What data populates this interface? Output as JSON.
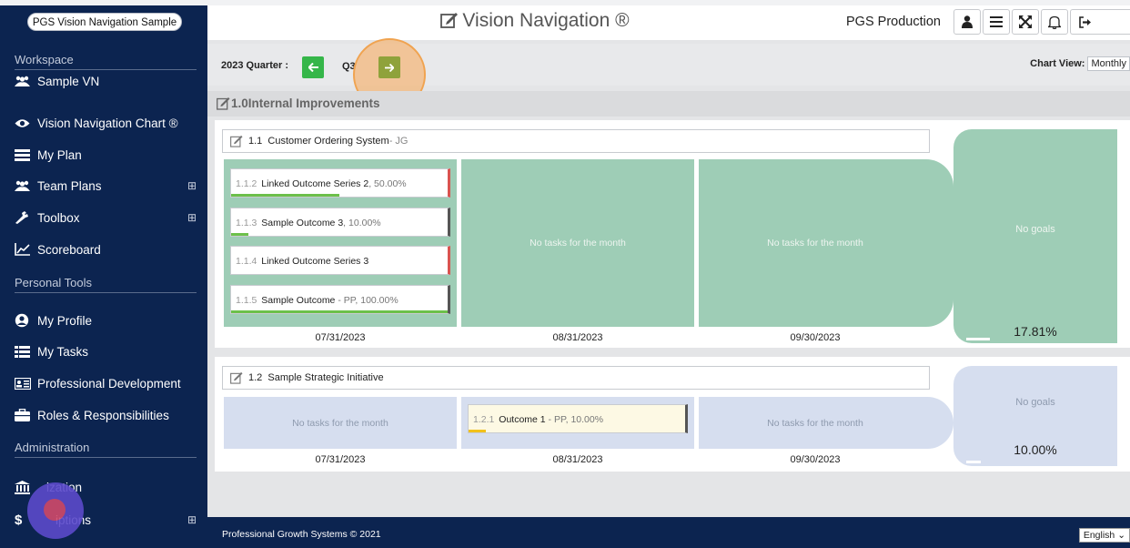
{
  "sidebar": {
    "brand": "PGS Vision Navigation Sample",
    "sections": {
      "workspace": "Workspace",
      "personal_tools": "Personal Tools",
      "administration": "Administration"
    },
    "items": [
      {
        "label": "Sample VN",
        "icon": "users-icon"
      },
      {
        "label": "Vision Navigation Chart ®",
        "icon": "eye-icon"
      },
      {
        "label": "My Plan",
        "icon": "plan-icon"
      },
      {
        "label": "Team Plans",
        "icon": "users-icon",
        "expand": "⊞"
      },
      {
        "label": "Toolbox",
        "icon": "wrench-icon",
        "expand": "⊞"
      },
      {
        "label": "Scoreboard",
        "icon": "chart-line-icon"
      },
      {
        "label": "My Profile",
        "icon": "profile-icon"
      },
      {
        "label": "My Tasks",
        "icon": "tasks-icon"
      },
      {
        "label": "Professional Development",
        "icon": "id-card-icon"
      },
      {
        "label": "Roles & Responsibilities",
        "icon": "briefcase-icon"
      },
      {
        "label": "ization",
        "icon": "bank-icon"
      },
      {
        "label": "iptions",
        "icon": "dollar-icon",
        "expand": "⊞"
      }
    ]
  },
  "header": {
    "title": "Vision Navigation ®",
    "org": "PGS Production"
  },
  "toolbar": {
    "quarter_label": "2023 Quarter :",
    "quarter_value": "Q3",
    "chart_view_label": "Chart View:",
    "chart_view_value": "Monthly"
  },
  "group": {
    "title": "1.0Internal Improvements"
  },
  "initiatives": [
    {
      "num": "1.1",
      "title": "Customer Ordering System",
      "owner": " - JG",
      "months": [
        {
          "date": "07/31/2023",
          "empty": ""
        },
        {
          "date": "08/31/2023",
          "empty": "No tasks for the month"
        },
        {
          "date": "09/30/2023",
          "empty": "No tasks for the month"
        }
      ],
      "outcomes": [
        {
          "num": "1.1.2",
          "title": "Linked Outcome Series 2",
          "meta": ", 50.00%",
          "progress": 0.5,
          "edge": "#d9534f"
        },
        {
          "num": "1.1.3",
          "title": "Sample Outcome 3",
          "meta": ", 10.00%",
          "progress": 0.1,
          "edge": "#555555"
        },
        {
          "num": "1.1.4",
          "title": "Linked Outcome Series 3",
          "meta": "",
          "progress": 0,
          "edge": "#d9534f"
        },
        {
          "num": "1.1.5",
          "title": "Sample Outcome",
          "meta": " - PP, 100.00%",
          "progress": 1.0,
          "edge": "#555555"
        }
      ],
      "goals_text": "No goals",
      "goals_pct": "17.81%",
      "goals_progress": 0.1781
    },
    {
      "num": "1.2",
      "title": "Sample Strategic Initiative",
      "owner": "",
      "months": [
        {
          "date": "07/31/2023",
          "empty": "No tasks for the month"
        },
        {
          "date": "08/31/2023",
          "empty": ""
        },
        {
          "date": "09/30/2023",
          "empty": "No tasks for the month"
        }
      ],
      "outcomes": [
        {
          "num": "1.2.1",
          "title": "Outcome 1",
          "meta": " - PP, 10.00%",
          "progress": 0.1,
          "edge": "#555555"
        }
      ],
      "goals_text": "No goals",
      "goals_pct": "10.00%",
      "goals_progress": 0.1
    }
  ],
  "footer": {
    "copyright": "Professional Growth Systems © 2021",
    "language": "English"
  },
  "colors": {
    "sidebar_bg": "#0c2450",
    "green_cell": "#9ecdb6",
    "blue_cell": "#d6deef",
    "nav_green": "#35b649",
    "nav_olive": "#8fa23b",
    "progress_green": "#6cc04a",
    "progress_yellow": "#f2c21b",
    "highlight_orange": "#f0a350"
  }
}
